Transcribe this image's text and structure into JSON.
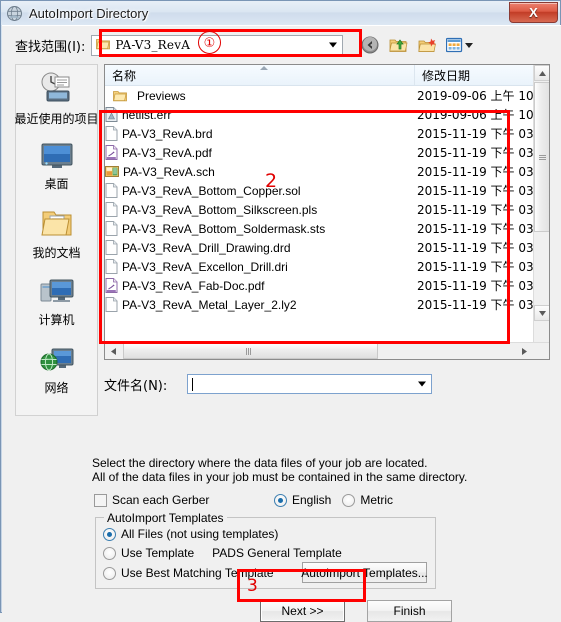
{
  "window": {
    "title": "AutoImport Directory",
    "icon": "globe-icon",
    "close_label": "X"
  },
  "lookin": {
    "label": "查找范围(I):",
    "value": "PA-V3_RevA",
    "folder_icon": "folder-icon",
    "dropdown_icon": "chevron-down-icon"
  },
  "toolbar": {
    "back": "back-icon",
    "up": "up-folder-icon",
    "newfolder": "new-folder-icon",
    "views": "views-icon"
  },
  "places": [
    {
      "label": "最近使用的项目",
      "icon": "recent-items-icon"
    },
    {
      "label": "桌面",
      "icon": "desktop-icon"
    },
    {
      "label": "我的文档",
      "icon": "my-documents-icon"
    },
    {
      "label": "计算机",
      "icon": "computer-icon"
    },
    {
      "label": "网络",
      "icon": "network-icon"
    }
  ],
  "filelist": {
    "columns": {
      "name": "名称",
      "date": "修改日期"
    },
    "rows": [
      {
        "name": "Previews",
        "date": "2019-09-06 上午 10...",
        "icon": "folder-icon",
        "kind": "folder"
      },
      {
        "name": "netlist.err",
        "date": "2019-09-06 上午 10...",
        "icon": "err-file-icon",
        "kind": "file"
      },
      {
        "name": "PA-V3_RevA.brd",
        "date": "2015-11-19 下午 03...",
        "icon": "blank-file-icon",
        "kind": "file"
      },
      {
        "name": "PA-V3_RevA.pdf",
        "date": "2015-11-19 下午 03...",
        "icon": "pdf-file-icon",
        "kind": "file"
      },
      {
        "name": "PA-V3_RevA.sch",
        "date": "2015-11-19 下午 03...",
        "icon": "sch-file-icon",
        "kind": "file"
      },
      {
        "name": "PA-V3_RevA_Bottom_Copper.sol",
        "date": "2015-11-19 下午 03...",
        "icon": "blank-file-icon",
        "kind": "file"
      },
      {
        "name": "PA-V3_RevA_Bottom_Silkscreen.pls",
        "date": "2015-11-19 下午 03...",
        "icon": "blank-file-icon",
        "kind": "file"
      },
      {
        "name": "PA-V3_RevA_Bottom_Soldermask.sts",
        "date": "2015-11-19 下午 03...",
        "icon": "blank-file-icon",
        "kind": "file"
      },
      {
        "name": "PA-V3_RevA_Drill_Drawing.drd",
        "date": "2015-11-19 下午 03...",
        "icon": "blank-file-icon",
        "kind": "file"
      },
      {
        "name": "PA-V3_RevA_Excellon_Drill.dri",
        "date": "2015-11-19 下午 03...",
        "icon": "blank-file-icon",
        "kind": "file"
      },
      {
        "name": "PA-V3_RevA_Fab-Doc.pdf",
        "date": "2015-11-19 下午 03...",
        "icon": "pdf-file-icon",
        "kind": "file"
      },
      {
        "name": "PA-V3_RevA_Metal_Layer_2.ly2",
        "date": "2015-11-19 下午 03...",
        "icon": "blank-file-icon",
        "kind": "file"
      }
    ]
  },
  "filename": {
    "label": "文件名(N):",
    "value": "",
    "dropdown_icon": "chevron-down-icon"
  },
  "instructions": {
    "line1": "Select the directory where the data files of your job are located.",
    "line2": "All of the data files in your job must be contained in the same directory."
  },
  "options": {
    "scan_each_gerber": {
      "label": "Scan each Gerber",
      "checked": false
    },
    "units": {
      "english": {
        "label": "English",
        "selected": true
      },
      "metric": {
        "label": "Metric",
        "selected": false
      }
    }
  },
  "templates": {
    "title": "AutoImport Templates",
    "all_files": {
      "label": "All Files (not using templates)",
      "selected": true
    },
    "use_template": {
      "label": "Use Template",
      "selected": false,
      "value": "PADS General Template"
    },
    "best_match": {
      "label": "Use Best Matching Template",
      "selected": false
    },
    "button": "AutoImport Templates..."
  },
  "buttons": {
    "next": "Next  >>",
    "finish": "Finish"
  },
  "annotations": {
    "one": "①",
    "two": "2",
    "three": "3",
    "color": "#ff0000"
  }
}
